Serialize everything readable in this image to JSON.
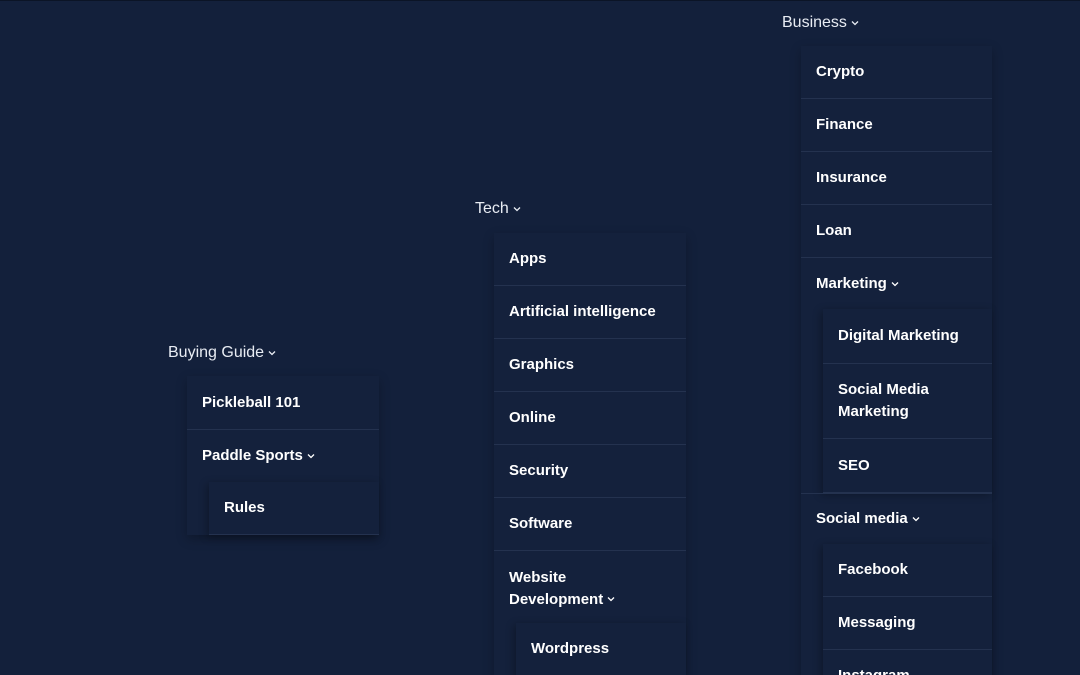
{
  "menus": {
    "buying_guide": {
      "label": "Buying Guide",
      "items": {
        "pickleball": "Pickleball 101",
        "paddle_sports": "Paddle Sports",
        "paddle_sub": {
          "rules": "Rules"
        }
      }
    },
    "tech": {
      "label": "Tech",
      "items": {
        "apps": "Apps",
        "ai": "Artificial intelligence",
        "graphics": "Graphics",
        "online": "Online",
        "security": "Security",
        "software": "Software",
        "webdev_line1": "Website",
        "webdev_line2": "Development",
        "webdev_sub": {
          "wordpress": "Wordpress"
        }
      }
    },
    "business": {
      "label": "Business",
      "items": {
        "crypto": "Crypto",
        "finance": "Finance",
        "insurance": "Insurance",
        "loan": "Loan",
        "marketing": "Marketing",
        "marketing_sub": {
          "digital": "Digital Marketing",
          "smm_line1": "Social Media",
          "smm_line2": "Marketing",
          "seo": "SEO"
        },
        "social_media": "Social media",
        "social_sub": {
          "facebook": "Facebook",
          "messaging": "Messaging",
          "instagram": "Instagram"
        }
      }
    }
  },
  "icons": {
    "expand": "chevron-down-icon"
  },
  "colors": {
    "background": "#13203b",
    "panel": "#14213c",
    "divider": "#24324f",
    "text": "#ffffff"
  }
}
